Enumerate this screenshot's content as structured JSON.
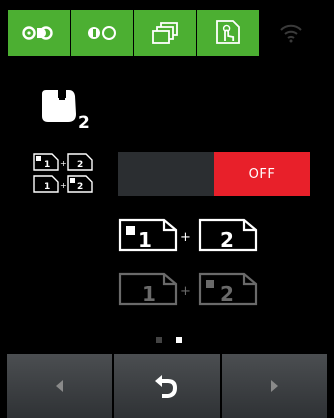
{
  "toolbar": {
    "tabs": [
      {
        "icon": "toner-cartridge-icon"
      },
      {
        "icon": "toner-save-icon"
      },
      {
        "icon": "copies-stack-icon"
      },
      {
        "icon": "touch-document-icon"
      },
      {
        "icon": "wifi-icon"
      }
    ]
  },
  "function": {
    "icon": "usb-2-icon",
    "number": "2"
  },
  "setting": {
    "icon": "id-copy-2in1-icon",
    "toggle_state": "OFF"
  },
  "illustration": {
    "top": {
      "left_page": "1",
      "plus": "+",
      "right_page": "2"
    },
    "bottom": {
      "left_page": "1",
      "plus": "+",
      "right_page": "2"
    }
  },
  "pager": {
    "pages": 2,
    "current": 2
  },
  "nav": {
    "prev": "left-arrow-icon",
    "back": "back-arrow-icon",
    "next": "right-arrow-icon"
  },
  "colors": {
    "accent": "#4caf32",
    "off": "#e8202a"
  }
}
